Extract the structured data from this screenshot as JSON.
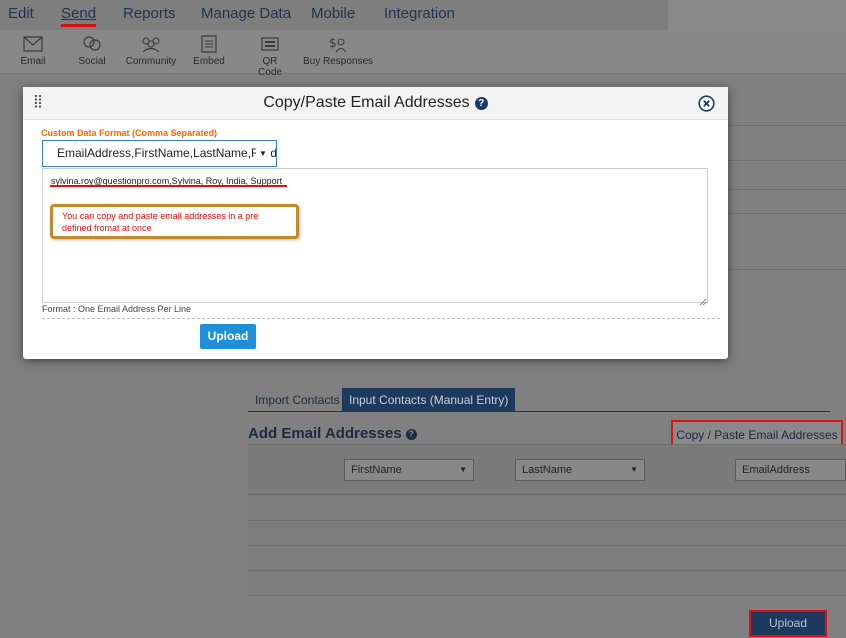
{
  "topnav": {
    "items": [
      {
        "label": "Edit"
      },
      {
        "label": "Send"
      },
      {
        "label": "Reports"
      },
      {
        "label": "Manage Data"
      },
      {
        "label": "Mobile"
      },
      {
        "label": "Integration"
      }
    ]
  },
  "subnav": {
    "items": [
      {
        "label": "Email",
        "icon": "envelope-icon"
      },
      {
        "label": "Social",
        "icon": "social-icon"
      },
      {
        "label": "Community",
        "icon": "community-icon"
      },
      {
        "label": "Embed",
        "icon": "embed-icon"
      },
      {
        "label": "QR Code",
        "icon": "qr-code-icon"
      },
      {
        "label": "Buy Responses",
        "icon": "buy-responses-icon"
      }
    ]
  },
  "tabs": {
    "import": "Import Contacts",
    "manual": "Input Contacts (Manual Entry)"
  },
  "add_section": {
    "title": "Add Email Addresses",
    "copy_paste": "Copy / Paste Email Addresses",
    "columns": [
      "FirstName",
      "LastName",
      "EmailAddress"
    ],
    "upload": "Upload"
  },
  "modal": {
    "title": "Copy/Paste Email Addresses",
    "format_label": "Custom Data Format (Comma Separated)",
    "format_value": "EmailAddress,FirstName,LastName,Field",
    "textarea_value": "sylvina.roy@questionpro.com,Sylvina, Roy, India, Support",
    "tooltip": "You can copy and paste email addresses in a pre defined fromat at once",
    "format_hint": "Format : One Email Address Per Line",
    "upload": "Upload"
  },
  "colors": {
    "accent": "#1e8fd8",
    "highlight": "#e01010",
    "label_orange": "#ff6600",
    "tab_active": "#1d3a5e"
  }
}
